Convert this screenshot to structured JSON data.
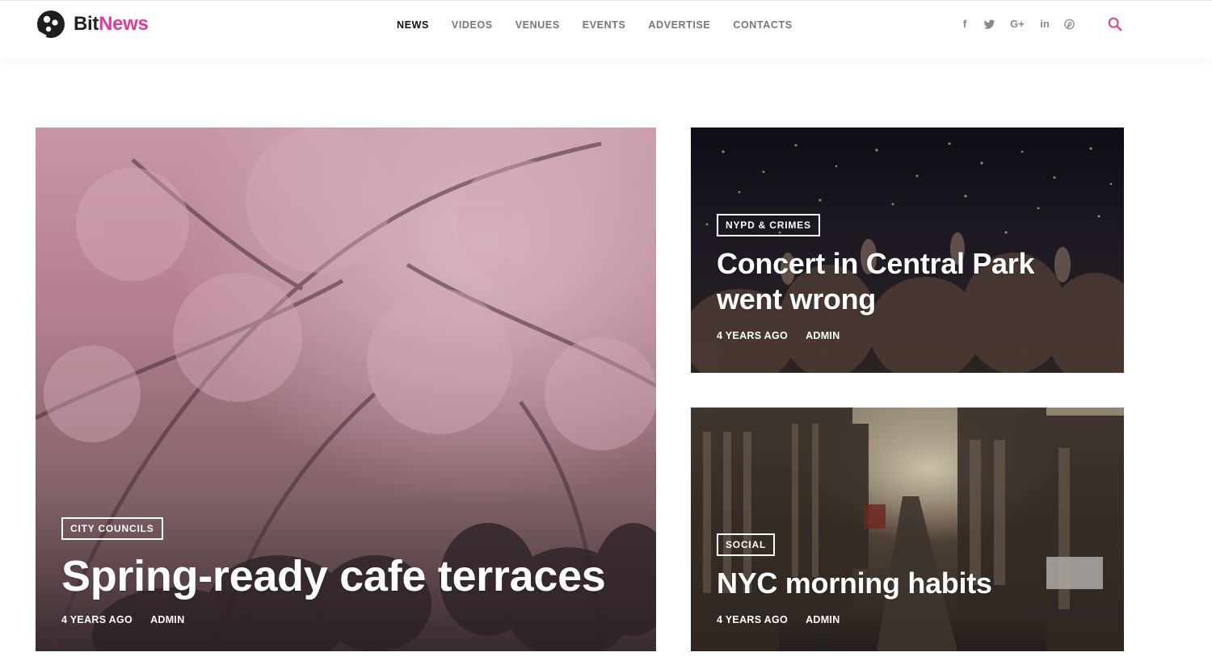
{
  "brand": {
    "name_part1": "Bit",
    "name_part2": "News",
    "accent": "#e0399f"
  },
  "nav": [
    {
      "label": "NEWS",
      "active": true
    },
    {
      "label": "VIDEOS",
      "active": false
    },
    {
      "label": "VENUES",
      "active": false
    },
    {
      "label": "EVENTS",
      "active": false
    },
    {
      "label": "ADVERTISE",
      "active": false
    },
    {
      "label": "CONTACTS",
      "active": false
    }
  ],
  "social": {
    "facebook": "f",
    "googleplus": "G+",
    "linkedin": "in",
    "icons": [
      "facebook-icon",
      "twitter-icon",
      "google-plus-icon",
      "linkedin-icon",
      "pinterest-icon"
    ]
  },
  "search_icon": "search-icon",
  "featured": [
    {
      "category": "CITY COUNCILS",
      "title": "Spring-ready cafe terraces",
      "time": "4 YEARS AGO",
      "author": "ADMIN",
      "image": "cherry blossom tree-lined street with crowd"
    },
    {
      "category": "NYPD & CRIMES",
      "title": "Concert in Central Park went wrong",
      "time": "4 YEARS AGO",
      "author": "ADMIN",
      "image": "concert crowd at night"
    },
    {
      "category": "SOCIAL",
      "title": "NYC morning habits",
      "time": "4 YEARS AGO",
      "author": "ADMIN",
      "image": "city street at sunrise"
    }
  ]
}
